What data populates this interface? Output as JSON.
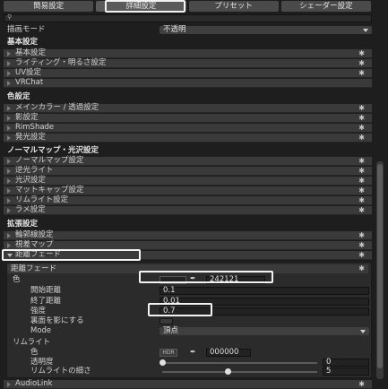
{
  "tabs": [
    {
      "label": "簡易設定",
      "active": false
    },
    {
      "label": "詳細設定",
      "active": true
    },
    {
      "label": "プリセット",
      "active": false
    },
    {
      "label": "シェーダー設定",
      "active": false
    }
  ],
  "search": {
    "placeholder": ""
  },
  "render_mode": {
    "label": "描画モード",
    "value": "不透明"
  },
  "sections": {
    "basic": {
      "title": "基本設定",
      "items": [
        "基本設定",
        "ライティング・明るさ設定",
        "UV設定",
        "VRChat"
      ]
    },
    "color": {
      "title": "色設定",
      "items": [
        "メインカラー / 透過設定",
        "影設定",
        "RimShade",
        "発光設定"
      ]
    },
    "normal": {
      "title": "ノーマルマップ・光沢設定",
      "items": [
        "ノーマルマップ設定",
        "逆光ライト",
        "光沢設定",
        "マットキャップ設定",
        "リムライト設定",
        "ラメ設定"
      ]
    },
    "ext": {
      "title": "拡張設定",
      "items": [
        "輪郭線設定",
        "視差マップ",
        "距離フェード"
      ]
    }
  },
  "distance_fade": {
    "title": "距離フェード",
    "color_label": "色",
    "color_hex": "242121",
    "swatch_color": "#242121",
    "start_label": "開始距離",
    "start_value": "0.1",
    "end_label": "終了距離",
    "end_value": "0.01",
    "strength_label": "強度",
    "strength_value": "0.7",
    "backface_label": "裏面を影にする",
    "mode_label": "Mode",
    "mode_value": "頂点"
  },
  "rimlight": {
    "title": "リムライト",
    "color_label": "色",
    "hdr_label": "HDR",
    "color_hex": "000000",
    "alpha_label": "透明度",
    "alpha_value": "0",
    "alpha_fraction": 0,
    "width_label": "リムライトの細さ",
    "width_value": "5",
    "width_fraction": 0.42
  },
  "audiolink": {
    "label": "AudioLink"
  },
  "icons": {
    "gear": "gear-icon",
    "search": "search-icon",
    "eyedropper": "eyedropper-icon"
  }
}
